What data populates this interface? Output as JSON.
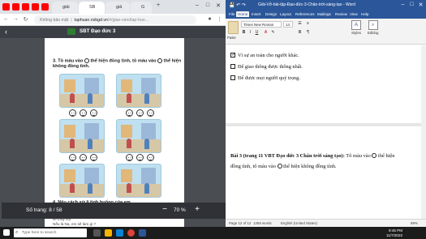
{
  "browser": {
    "tabs": [
      {
        "label": "",
        "favicon_color": "#ff0000"
      },
      {
        "label": "",
        "favicon_color": "#ff0000"
      },
      {
        "label": "",
        "favicon_color": "#ff0000"
      },
      {
        "label": "",
        "favicon_color": "#ff0000"
      },
      {
        "label": "",
        "favicon_color": "#ff0000"
      },
      {
        "label": "giải",
        "favicon_color": "#4285f4"
      },
      {
        "label": "SB",
        "favicon_color": "#1a73e8"
      },
      {
        "label": "giả",
        "favicon_color": "#4285f4"
      },
      {
        "label": "G",
        "favicon_color": "#4285f4"
      }
    ],
    "address": {
      "warning": "Không bảo mật",
      "host": "taphuan.nxbgd.vn",
      "path": "/#/giao-vien/tap-huo..."
    },
    "doc_title": "SBT Đạo đức 3"
  },
  "document": {
    "task3_line1": "3. Tô màu vào",
    "task3_mid": "thể hiện đồng tình, tô màu vào",
    "task3_end": "thể hiện",
    "task3_line2": "không đồng tình.",
    "task4_heading": "4. Nêu cách xử lí tình huống của em.",
    "task4_line1": "• Tình huống 1: Chị hàng xóm cũ ha đi xuống đến chợ nói: 'Đa",
    "task4_line2": "  Anh ơi em chưa đủ mẫu nhung em vào'. 'Không bảo",
    "task4_line3": "  sẽ thấy vui.'",
    "task4_line4": "Nếu là Na, em sẽ làm gì ?"
  },
  "viewer": {
    "page_label": "Số trang:",
    "page_value": "8 / 58",
    "zoom_value": "70 %",
    "zoom_minus": "−",
    "zoom_plus": "+"
  },
  "word": {
    "window_title": "Giải-Vở-bài-tập-Đạo-đức-3-Chân-trời-sáng-tạo - Word",
    "tabs": [
      "File",
      "Home",
      "Insert",
      "Design",
      "Layout",
      "References",
      "Mailings",
      "Review",
      "View",
      "Help"
    ],
    "active_tab": "Home",
    "font": "Times New Roman",
    "font_size": "14",
    "paste_label": "Paste",
    "styles_label": "Styles",
    "editing_label": "Editing",
    "checklist": [
      {
        "text": "Vì sự an toàn cho người khác.",
        "checked": true
      },
      {
        "text": "Để giao thông được thông nhất.",
        "checked": false
      },
      {
        "text": "Để được mọi người quý trọng.",
        "checked": false
      }
    ],
    "para_bold": "Bài 3 (trang 11 VBT Đạo đức 3 Chân trời sáng tạo):",
    "para_text1": " Tô màu vào",
    "para_text2": " thể hiện",
    "para_text3": "đồng tình, tô màu vào",
    "para_text4": " thể hiện không đồng tình.",
    "status_page": "Page 12 of 12",
    "status_words": "1258 words",
    "status_lang": "English (United States)",
    "status_zoom": "99%"
  },
  "taskbar": {
    "search_placeholder": "Type here to search",
    "time": "9:45 PM",
    "date": "11/7/2022"
  }
}
